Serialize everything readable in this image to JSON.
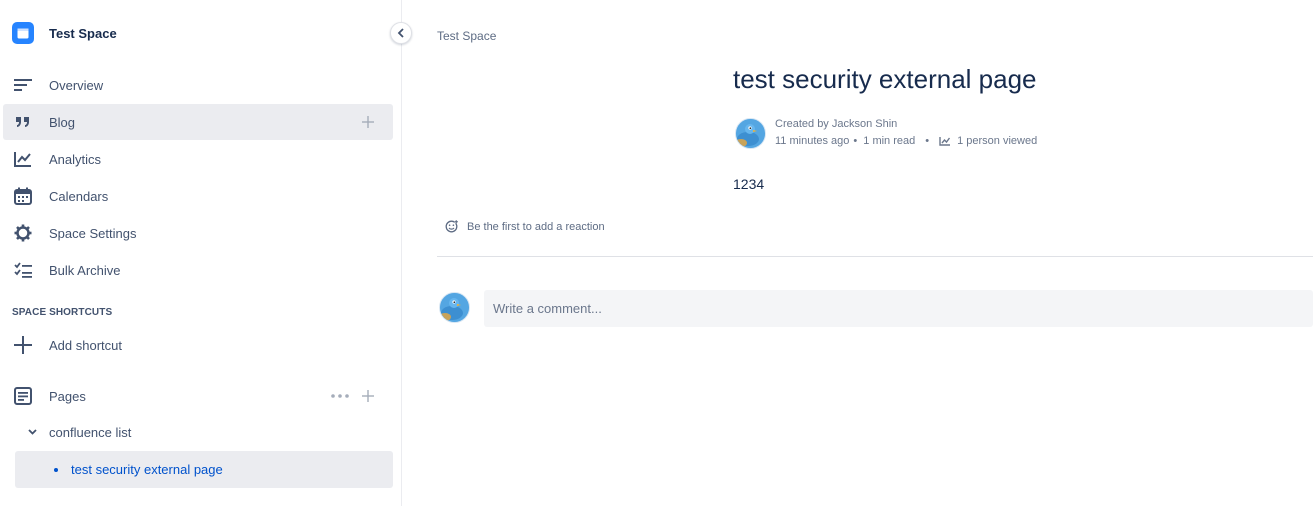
{
  "sidebar": {
    "space_name": "Test Space",
    "items": [
      {
        "label": "Overview",
        "icon": "overview-icon"
      },
      {
        "label": "Blog",
        "icon": "quote-icon"
      },
      {
        "label": "Analytics",
        "icon": "analytics-icon"
      },
      {
        "label": "Calendars",
        "icon": "calendar-icon"
      },
      {
        "label": "Space Settings",
        "icon": "gear-icon"
      },
      {
        "label": "Bulk Archive",
        "icon": "bulk-archive-icon"
      }
    ],
    "shortcuts_title": "SPACE SHORTCUTS",
    "add_shortcut": "Add shortcut",
    "pages_label": "Pages",
    "tree": {
      "parent": "confluence list",
      "child": "test security external page"
    }
  },
  "main": {
    "breadcrumb": "Test Space",
    "title": "test security external page",
    "byline": {
      "created_by": "Created by Jackson Shin",
      "time": "11 minutes ago",
      "read_time": "1 min read",
      "views": "1 person viewed"
    },
    "body": "1234",
    "reaction_prompt": "Be the first to add a reaction",
    "comment_placeholder": "Write a comment..."
  },
  "colors": {
    "accent": "#2684ff",
    "text": "#172b4d",
    "link": "#0052cc",
    "active_bg": "#ebecf0"
  }
}
